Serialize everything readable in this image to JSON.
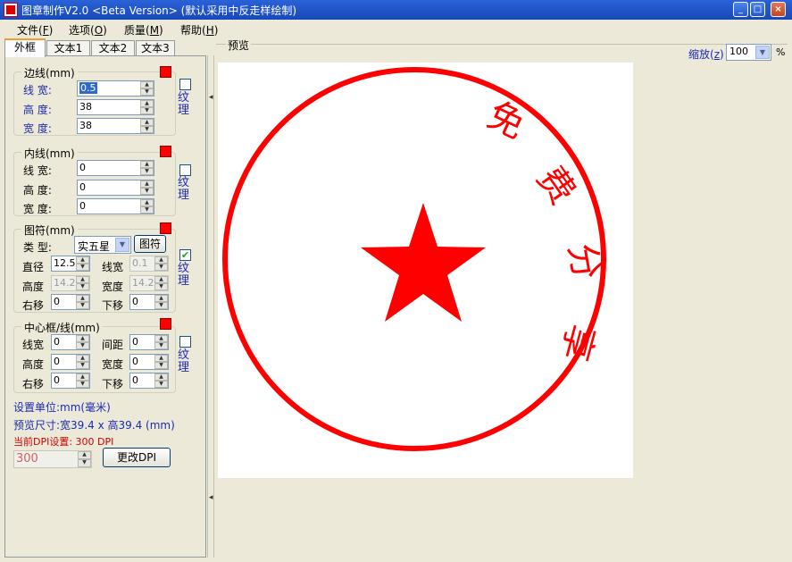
{
  "window": {
    "title": "图章制作V2.0 <Beta Version> (默认采用中反走样绘制)"
  },
  "menu": [
    {
      "label": "文件(",
      "key": "F",
      "end": ")"
    },
    {
      "label": "选项(",
      "key": "O",
      "end": ")"
    },
    {
      "label": "质量(",
      "key": "M",
      "end": ")"
    },
    {
      "label": "帮助(",
      "key": "H",
      "end": ")"
    }
  ],
  "tabs": [
    "外框",
    "文本1",
    "文本2",
    "文本3"
  ],
  "border_group": {
    "title": "边线(mm)",
    "line_width_label": "线  宽:",
    "line_width": "0.5",
    "height_label": "高  度:",
    "height": "38",
    "width_label": "宽  度:",
    "width": "38",
    "texture_label": "纹理"
  },
  "inner_group": {
    "title": "内线(mm)",
    "line_width_label": "线  宽:",
    "line_width": "0",
    "height_label": "高  度:",
    "height": "0",
    "width_label": "宽  度:",
    "width": "0",
    "texture_label": "纹理"
  },
  "symbol_group": {
    "title": "图符(mm)",
    "type_label": "类  型:",
    "type_value": "实五星",
    "symbol_button": "图符",
    "diameter_label": "直径",
    "diameter": "12.5",
    "line_width_label": "线宽",
    "line_width": "0.1",
    "height_label": "高度",
    "height": "14.2",
    "width_label": "宽度",
    "width": "14.2",
    "right_label": "右移",
    "right": "0",
    "down_label": "下移",
    "down": "0",
    "texture_label": "纹理"
  },
  "center_group": {
    "title": "中心框/线(mm)",
    "line_width_label": "线宽",
    "line_width": "0",
    "spacing_label": "间距",
    "spacing": "0",
    "height_label": "高度",
    "height": "0",
    "width_label": "宽度",
    "width": "0",
    "right_label": "右移",
    "right": "0",
    "down_label": "下移",
    "down": "0",
    "texture_label": "纹理"
  },
  "info": {
    "unit": "设置单位:mm(毫米)",
    "preview_size": "预览尺寸:宽39.4 x 高39.4 (mm)",
    "dpi_setting": "当前DPI设置: 300 DPI",
    "dpi_value": "300",
    "change_dpi_button": "更改DPI"
  },
  "preview": {
    "title": "预览",
    "zoom_label": "缩放(",
    "zoom_key": "z",
    "zoom_end": ")",
    "zoom_value": "100",
    "zoom_unit": "%",
    "seal_chars": [
      "免",
      "费",
      "分",
      "享"
    ],
    "seal_color": "#ff0000"
  },
  "colors": {
    "swatch": "#ff0000",
    "label_blue": "#1a2ab0",
    "dpi_red": "#d00000"
  }
}
